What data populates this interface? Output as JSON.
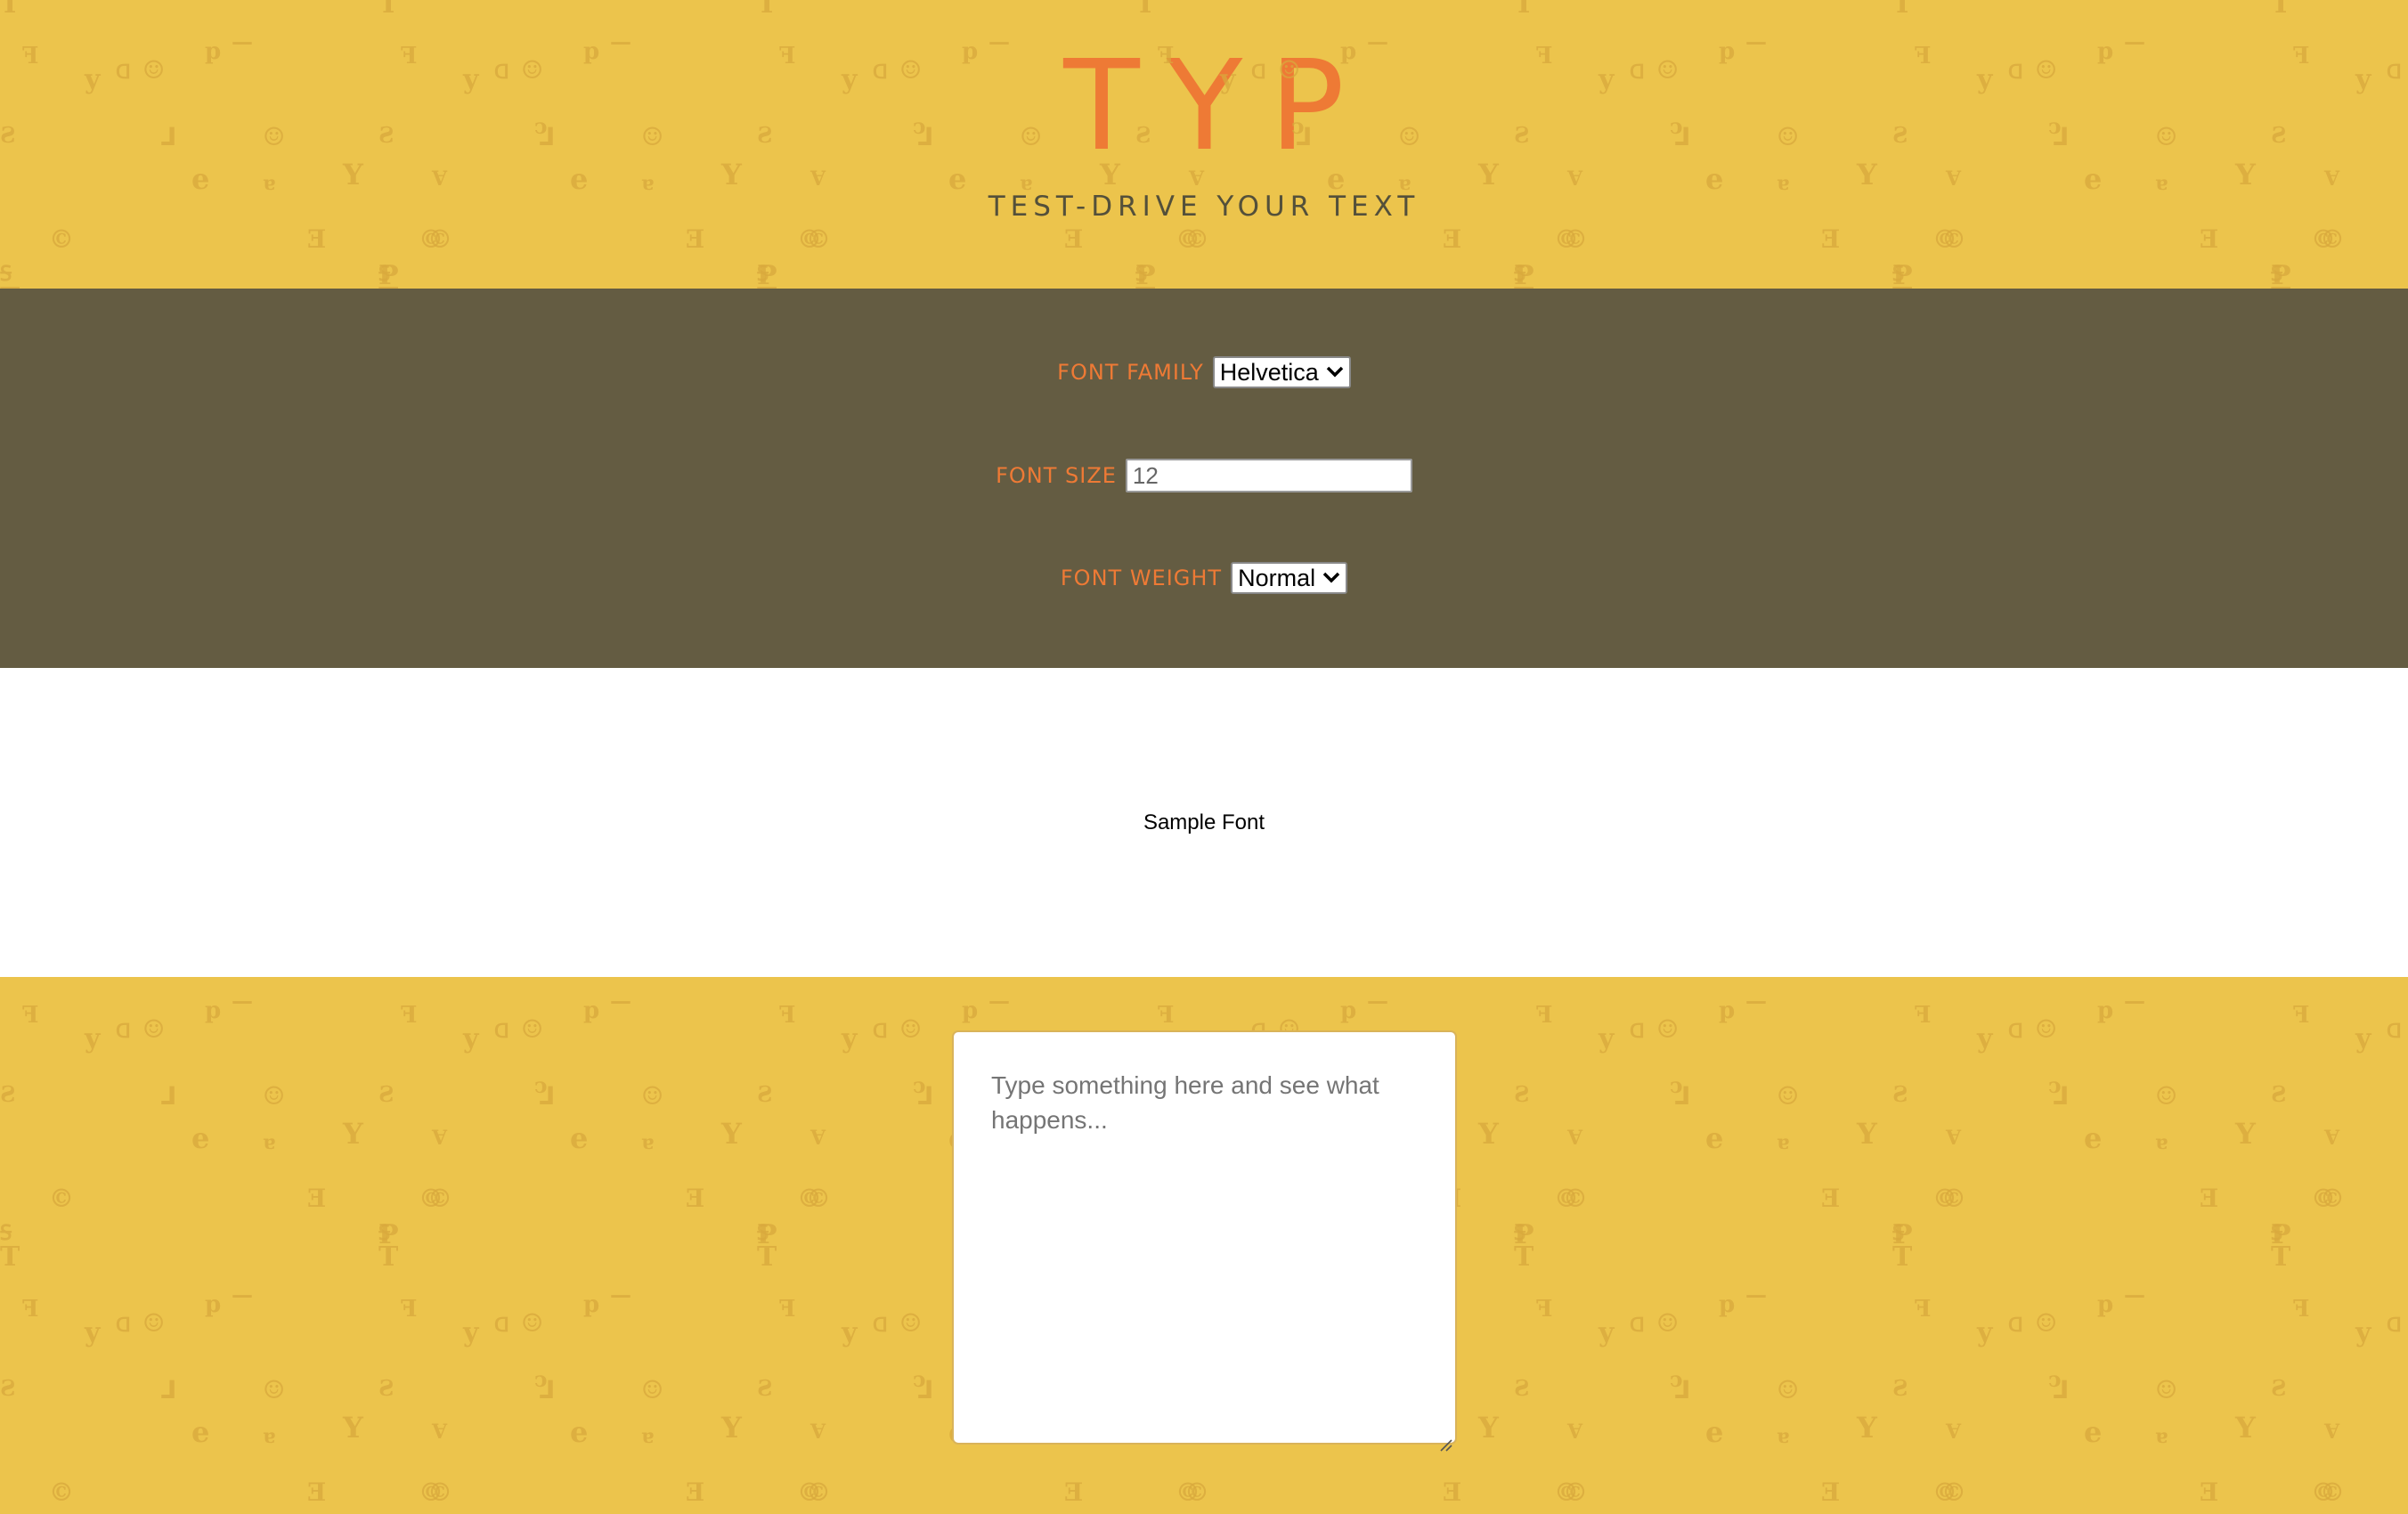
{
  "app": {
    "title": "TYP",
    "subtitle": "TEST-DRIVE YOUR TEXT"
  },
  "controls": {
    "font_family": {
      "label": "FONT FAMILY",
      "value": "Helvetica"
    },
    "font_size": {
      "label": "FONT SIZE",
      "value": "12"
    },
    "font_weight": {
      "label": "FONT WEIGHT",
      "value": "Normal"
    }
  },
  "preview": {
    "sample_text": "Sample Font"
  },
  "editor": {
    "placeholder": "Type something here and see what happens..."
  },
  "theme": {
    "background": "#ecc44c",
    "panel": "#645c42",
    "accent": "#ee7a35",
    "pattern_glyph": "#d9a93c"
  },
  "icons": {
    "select_arrow": "chevron-down-icon",
    "resize_handle": "resize-handle-icon"
  }
}
